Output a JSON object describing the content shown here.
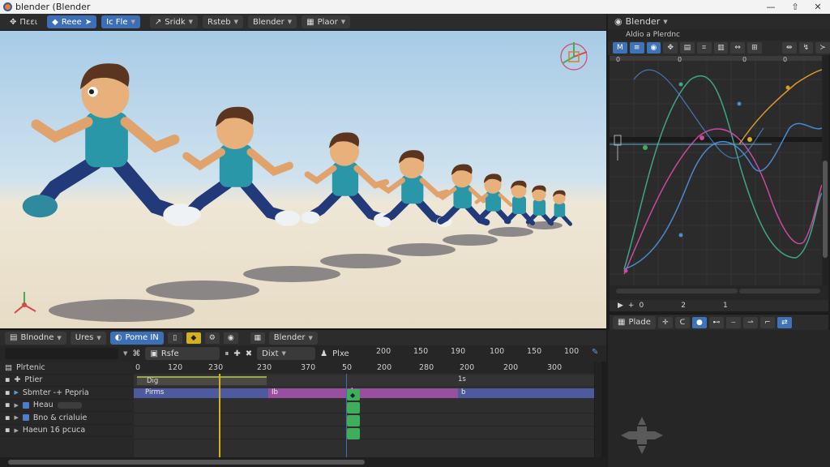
{
  "window": {
    "title": "blender (Blender",
    "controls": [
      "—",
      "⇧",
      "✕"
    ]
  },
  "viewport_header": {
    "editor_menu": "Πεει",
    "mode": "Reee",
    "view_btn": "Ic Fle",
    "select_btn": "Sridk",
    "object_btn": "Rsteb",
    "scene_btn": "Blender",
    "layer_btn": "Plaor"
  },
  "graph_panel": {
    "title": "Blender",
    "subtitle": "Aldio a Plerdnc",
    "footer": [
      "+",
      "0",
      "2",
      "1"
    ]
  },
  "graph_bottom": {
    "label": "Plade"
  },
  "dope_header": {
    "editor": "Blnodne",
    "mode": "Ures",
    "action": "Pome IN",
    "scene": "Blender"
  },
  "dope_filter": {
    "search": "Rsfe",
    "dup": "Dixt",
    "mix": "Plxe"
  },
  "dope_ruler": {
    "ticks": [
      {
        "label": "0"
      },
      {
        "label": "120"
      },
      {
        "label": "230"
      },
      {
        "label": "230"
      },
      {
        "label": "370"
      },
      {
        "label": "50"
      },
      {
        "label": "200"
      },
      {
        "label": "280"
      },
      {
        "label": "200"
      },
      {
        "label": "200"
      },
      {
        "label": "300"
      }
    ],
    "top_ticks": [
      "200",
      "150",
      "190",
      "100",
      "150",
      "100"
    ]
  },
  "dope_channels": [
    {
      "name": "Plrtenic"
    },
    {
      "name": "Ptier"
    },
    {
      "name": "Sbmter -+ Pepria"
    },
    {
      "name": "Heau"
    },
    {
      "name": "Bno & crialuie"
    },
    {
      "name": "Haeun 16 pcuca"
    }
  ],
  "dope_strips": [
    {
      "label": "Dig",
      "value": "1s"
    },
    {
      "label": "Pirms",
      "value": "Ib"
    },
    {
      "label": "b",
      "value": "b"
    }
  ],
  "colors": {
    "accent": "#3d6fb6",
    "playhead": "#d3b024",
    "keyframe": "#3fae5a"
  }
}
